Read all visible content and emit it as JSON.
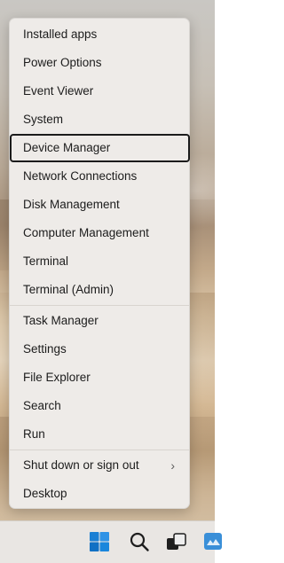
{
  "menu": {
    "items": [
      {
        "label": "Installed apps"
      },
      {
        "label": "Power Options"
      },
      {
        "label": "Event Viewer"
      },
      {
        "label": "System"
      },
      {
        "label": "Device Manager",
        "focused": true
      },
      {
        "label": "Network Connections"
      },
      {
        "label": "Disk Management"
      },
      {
        "label": "Computer Management"
      },
      {
        "label": "Terminal"
      },
      {
        "label": "Terminal (Admin)"
      },
      {
        "label": "Task Manager"
      },
      {
        "label": "Settings"
      },
      {
        "label": "File Explorer"
      },
      {
        "label": "Search"
      },
      {
        "label": "Run"
      },
      {
        "label": "Shut down or sign out",
        "submenu": true
      },
      {
        "label": "Desktop"
      }
    ],
    "submenu_chevron": "›"
  },
  "taskbar": {
    "icons": [
      "windows-start-icon",
      "search-icon",
      "task-view-icon",
      "widgets-icon"
    ]
  }
}
